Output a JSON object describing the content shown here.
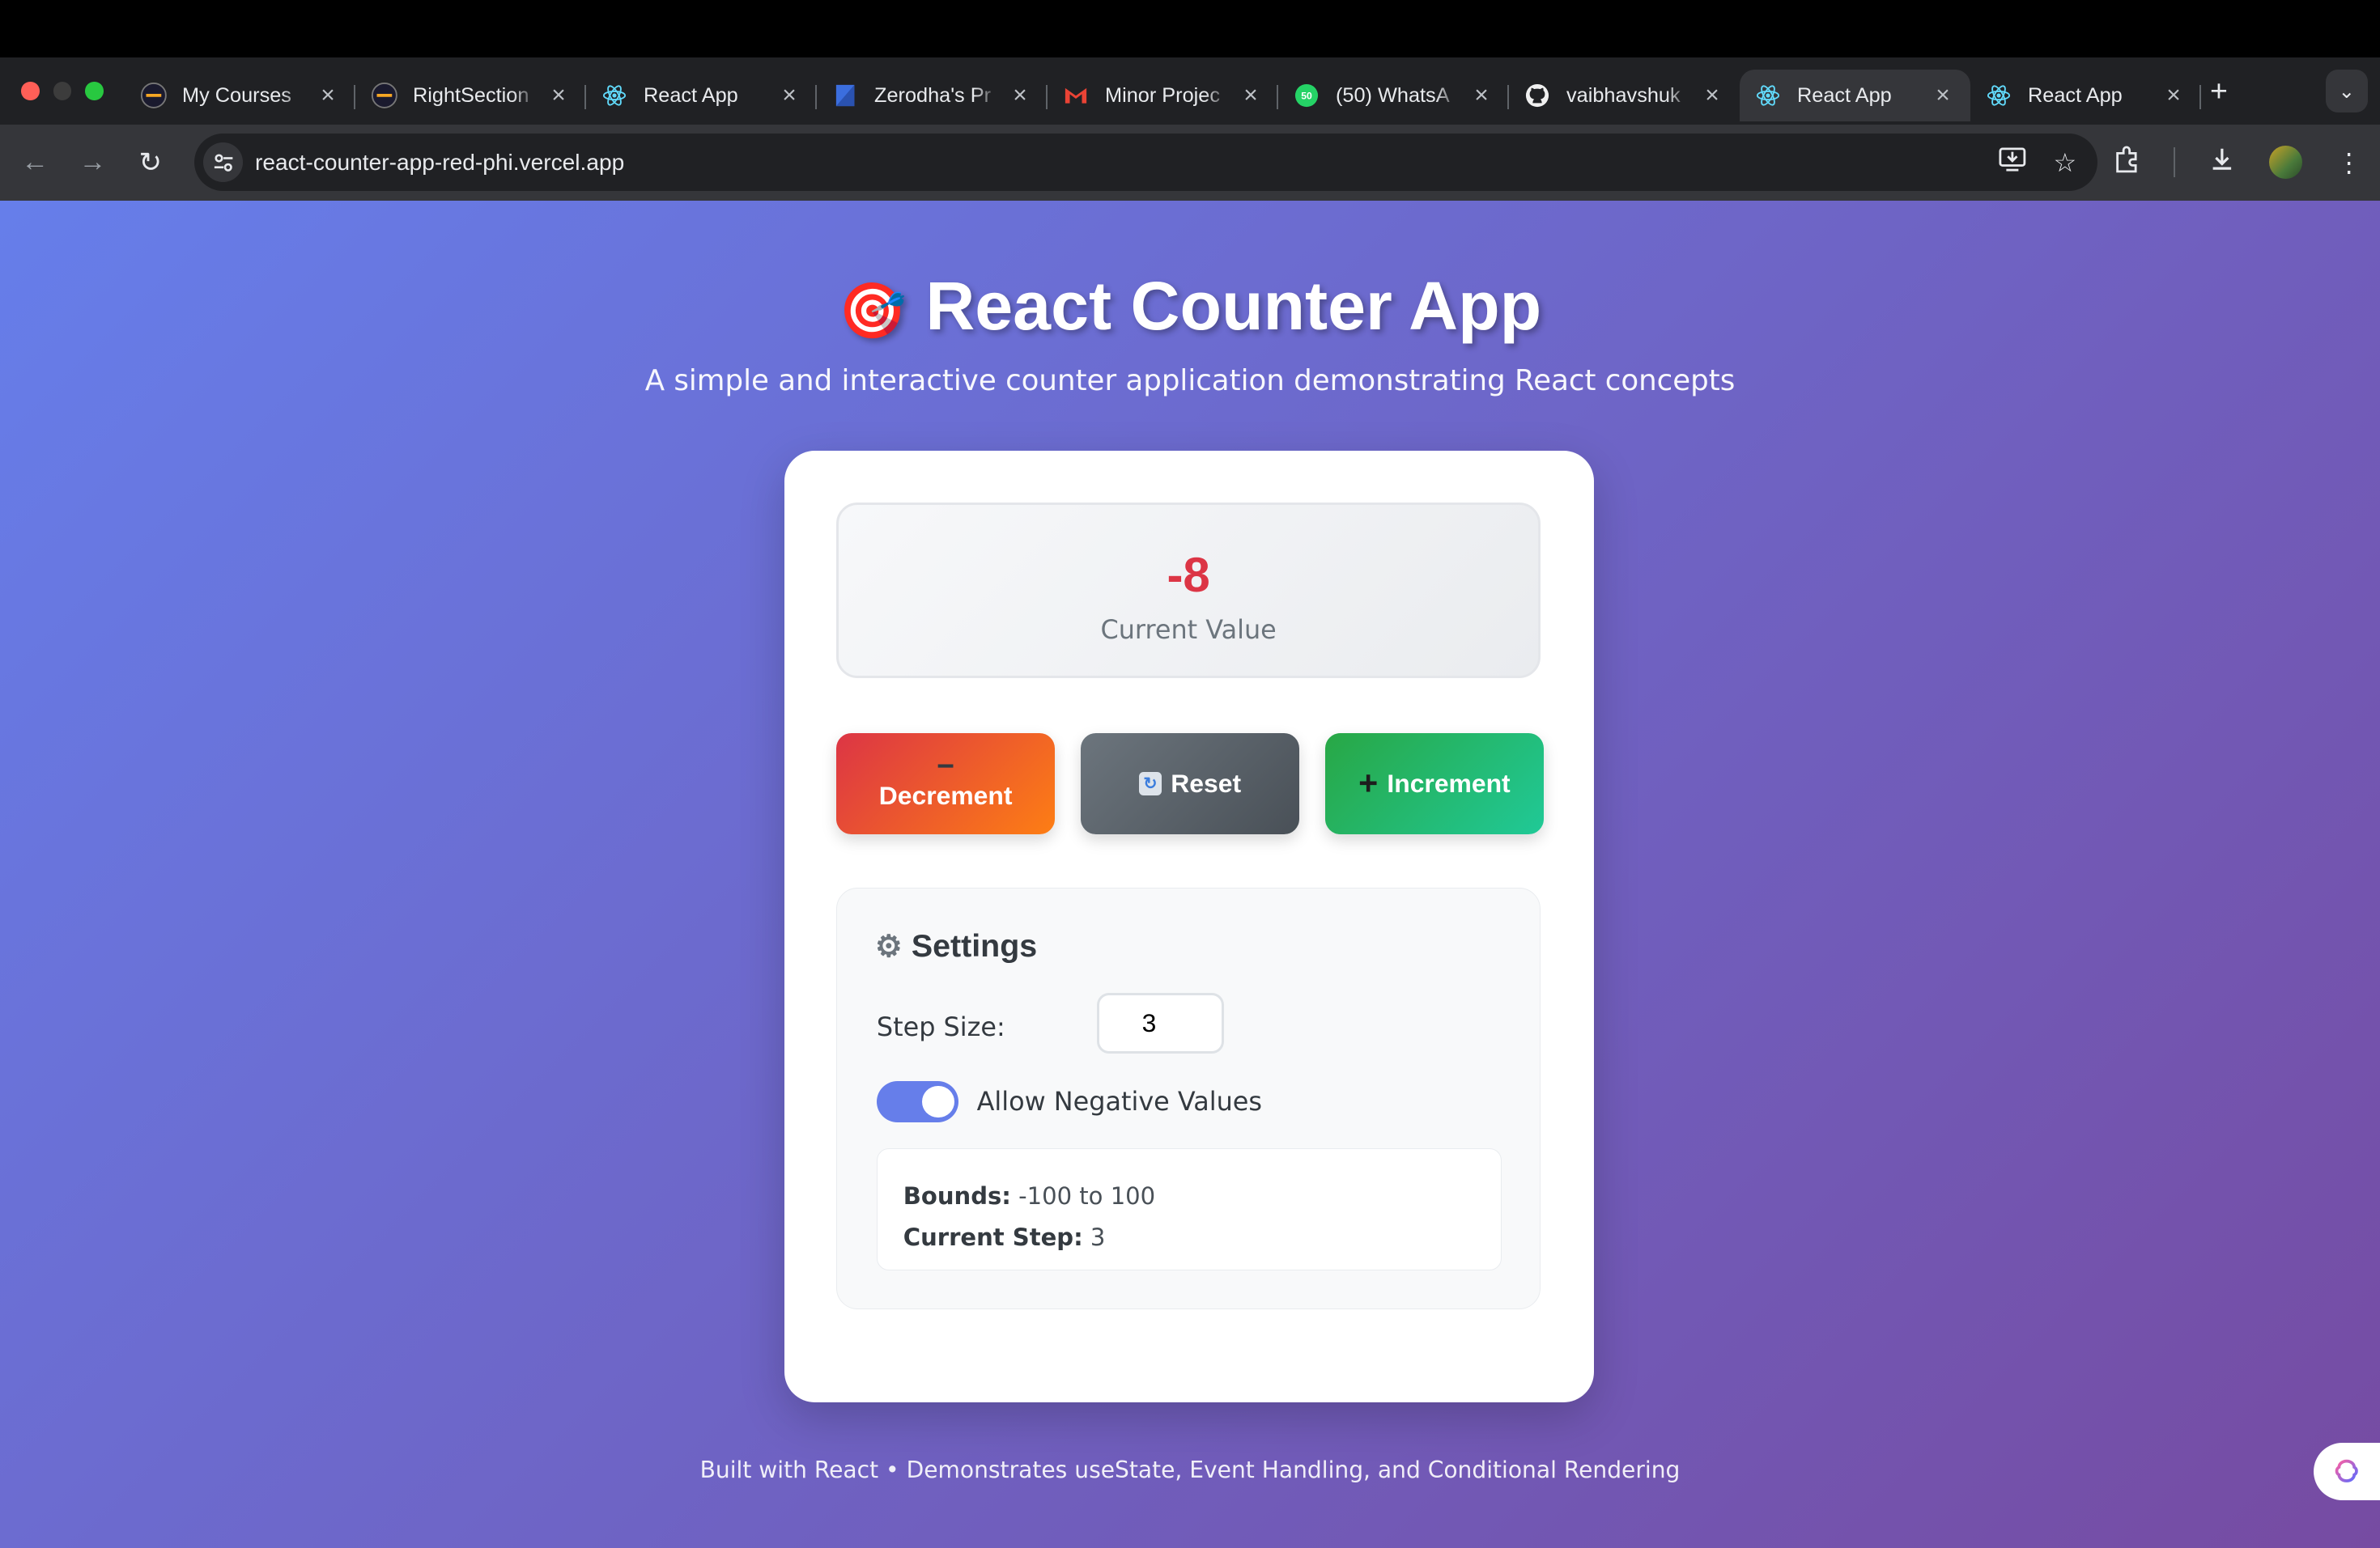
{
  "browser": {
    "tabs": [
      {
        "title": "My Courses",
        "icon": "course-logo-icon",
        "active": false
      },
      {
        "title": "RightSection",
        "icon": "course-logo-icon",
        "active": false
      },
      {
        "title": "React App",
        "icon": "react-icon",
        "active": false
      },
      {
        "title": "Zerodha's Pr",
        "icon": "bookmark-doc-icon",
        "active": false
      },
      {
        "title": "Minor Projec",
        "icon": "gmail-icon",
        "active": false
      },
      {
        "title": "(50) WhatsA",
        "icon": "whatsapp-icon",
        "active": false
      },
      {
        "title": "vaibhavshuk",
        "icon": "github-icon",
        "active": false
      },
      {
        "title": "React App",
        "icon": "react-icon",
        "active": true
      },
      {
        "title": "React App",
        "icon": "react-icon",
        "active": false
      }
    ],
    "whatsapp_badge": "50",
    "url": "react-counter-app-red-phi.vercel.app"
  },
  "app": {
    "title_emoji": "🎯",
    "title": "React Counter App",
    "subtitle": "A simple and interactive counter application demonstrating React concepts",
    "counter": {
      "value": "-8",
      "label": "Current Value",
      "value_color": "#dc3545"
    },
    "buttons": {
      "decrement_symbol": "−",
      "decrement": "Decrement",
      "reset": "Reset",
      "increment_symbol": "+",
      "increment": "Increment"
    },
    "settings": {
      "heading": "Settings",
      "step_label": "Step Size:",
      "step_value": "3",
      "toggle_label": "Allow Negative Values",
      "allow_negative": true,
      "bounds_label": "Bounds:",
      "bounds_value": "-100 to 100",
      "current_step_label": "Current Step:",
      "current_step_value": "3"
    },
    "footer": "Built with React • Demonstrates useState, Event Handling, and Conditional Rendering"
  },
  "colors": {
    "bg_start": "#667eea",
    "bg_end": "#764ba2",
    "decrement": "#dc3545",
    "increment": "#28a745",
    "reset": "#6c757d",
    "toggle_on": "#667eea"
  }
}
